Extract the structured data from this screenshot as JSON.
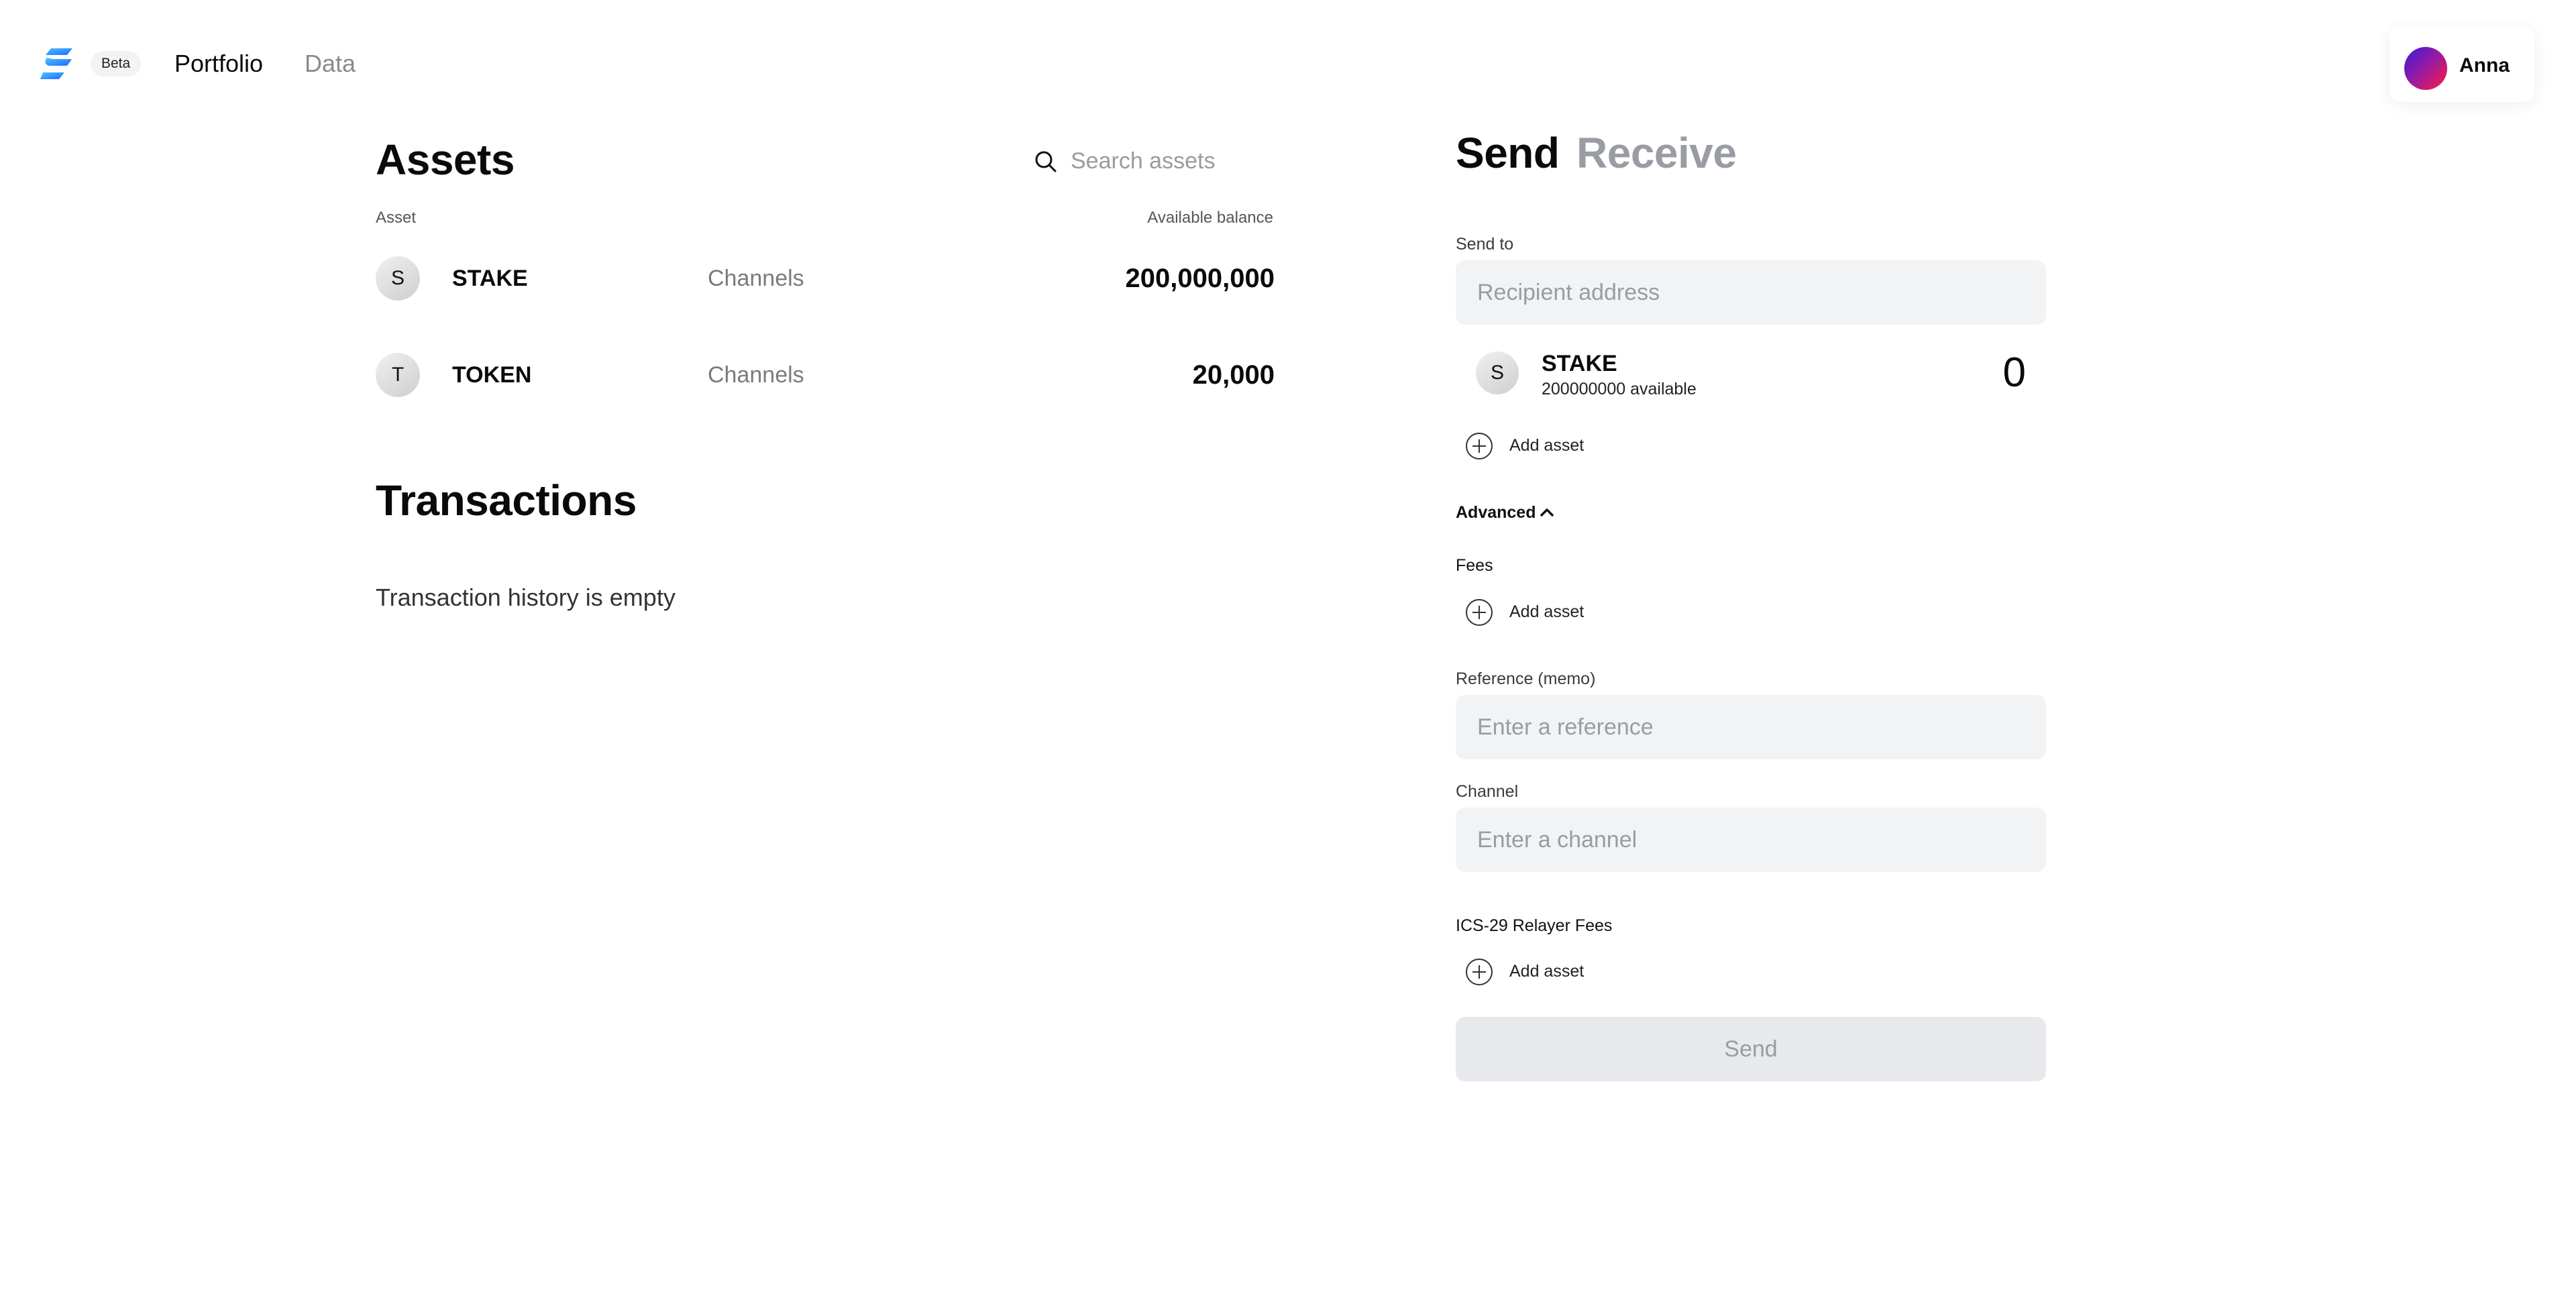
{
  "header": {
    "beta_label": "Beta",
    "nav": [
      {
        "label": "Portfolio",
        "active": true
      },
      {
        "label": "Data",
        "active": false
      }
    ],
    "user": {
      "name": "Anna"
    }
  },
  "assets": {
    "title": "Assets",
    "search_placeholder": "Search assets",
    "col_asset": "Asset",
    "col_balance": "Available balance",
    "rows": [
      {
        "initial": "S",
        "name": "STAKE",
        "channels": "Channels",
        "balance": "200,000,000"
      },
      {
        "initial": "T",
        "name": "TOKEN",
        "channels": "Channels",
        "balance": "20,000"
      }
    ]
  },
  "transactions": {
    "title": "Transactions",
    "empty_text": "Transaction history is empty"
  },
  "send_panel": {
    "tab_send": "Send",
    "tab_receive": "Receive",
    "send_to_label": "Send to",
    "recipient_placeholder": "Recipient address",
    "selected_asset": {
      "initial": "S",
      "name": "STAKE",
      "available": "200000000 available",
      "amount": "0"
    },
    "add_asset_label": "Add asset",
    "advanced_label": "Advanced",
    "fees_label": "Fees",
    "reference_label": "Reference (memo)",
    "reference_placeholder": "Enter a reference",
    "channel_label": "Channel",
    "channel_placeholder": "Enter a channel",
    "relayer_fees_label": "ICS-29 Relayer Fees",
    "send_button": "Send"
  },
  "colors": {
    "text_primary": "#0a0a0a",
    "text_muted": "#9a9ca4",
    "field_bg": "#f2f3f5",
    "button_disabled_bg": "#e8e9ec",
    "logo_blue": "#1e8cff"
  },
  "icons": [
    "logo-icon",
    "search-icon",
    "plus-circle-icon",
    "chevron-up-icon"
  ]
}
